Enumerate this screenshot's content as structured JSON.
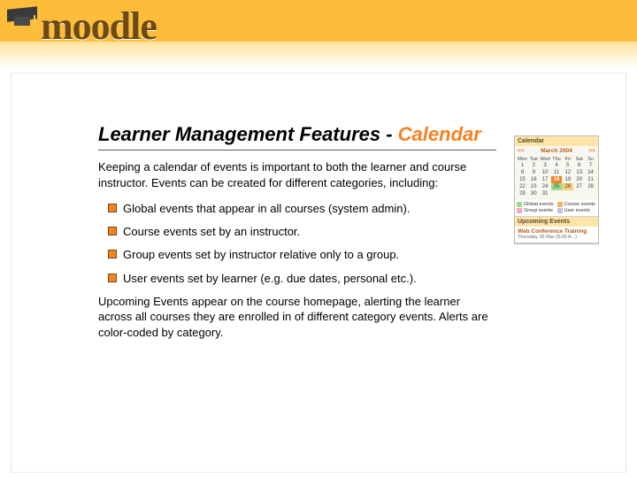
{
  "logo_text": "moodle",
  "title_prefix": "Learner Management Features - ",
  "title_accent": "Calendar",
  "intro": "Keeping a calendar of events is important to both the learner and course instructor.  Events can be created for different categories, including:",
  "bullets": [
    "Global events that appear in all courses (system admin).",
    "Course events set by an instructor.",
    "Group events set by instructor relative only to a group.",
    "User events set by learner (e.g. due dates, personal etc.)."
  ],
  "outro": "Upcoming Events appear on the course homepage, alerting the learner across all courses they are enrolled in of different category events.  Alerts are color-coded by category.",
  "calendar": {
    "title": "Calendar",
    "prev": "<<",
    "next": ">>",
    "month": "March 2004",
    "day_headers": [
      "Mon",
      "Tue",
      "Wed",
      "Thu",
      "Fri",
      "Sat",
      "Su"
    ],
    "weeks": [
      [
        "1",
        "2",
        "3",
        "4",
        "5",
        "6",
        "7"
      ],
      [
        "8",
        "9",
        "10",
        "11",
        "12",
        "13",
        "14"
      ],
      [
        "15",
        "16",
        "17",
        "18",
        "19",
        "20",
        "21"
      ],
      [
        "22",
        "23",
        "24",
        "25",
        "26",
        "27",
        "28"
      ],
      [
        "29",
        "30",
        "31",
        "",
        "",
        "",
        ""
      ]
    ],
    "selected": "18",
    "highlight_green": [
      "25"
    ],
    "highlight_orange": [
      "26"
    ],
    "legend": [
      "Global events",
      "Course events",
      "Group events",
      "User events"
    ]
  },
  "upcoming": {
    "title": "Upcoming Events",
    "event_title": "Web Conference Training",
    "event_sub": "Thursday 25 Mar (9:00 A...)"
  }
}
